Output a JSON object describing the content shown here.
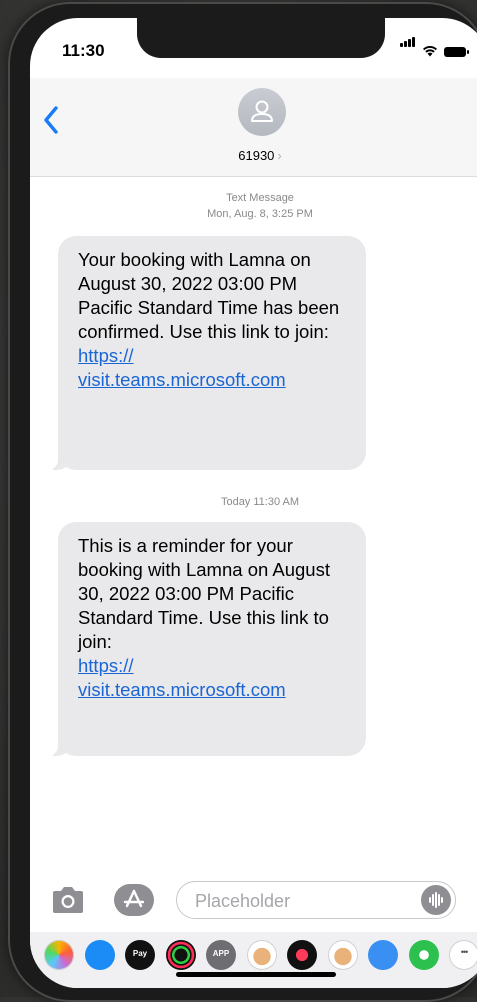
{
  "status_bar": {
    "time": "11:30"
  },
  "header": {
    "contact_name": "61930",
    "contact_chevron": "›"
  },
  "thread": {
    "messages": [
      {
        "timestamp_label": "Text Message",
        "timestamp": "Mon, Aug. 8, 3:25 PM",
        "body": "Your booking with Lamna on August 30, 2022 03:00 PM Pacific Standard Time has been confirmed. Use this link to join:",
        "link_line1": "https://",
        "link_line2": "visit.teams.microsoft.com"
      },
      {
        "timestamp": "Today 11:30 AM",
        "body": "This is a reminder for your booking with Lamna on August 30, 2022 03:00 PM Pacific Standard Time. Use this link to join:",
        "link_line1": "https://",
        "link_line2": "visit.teams.microsoft.com"
      }
    ]
  },
  "composer": {
    "placeholder": "Placeholder"
  },
  "app_drawer": {
    "apps": [
      {
        "name": "photos-app-icon",
        "color": "#ffffff"
      },
      {
        "name": "app-store-icon",
        "color": "#1b8cf5"
      },
      {
        "name": "apple-pay-icon",
        "color": "#111111",
        "label": "Pay"
      },
      {
        "name": "fitness-icon",
        "color": "#111111"
      },
      {
        "name": "app-clips-icon",
        "color": "#6d6d72",
        "label": "APP"
      },
      {
        "name": "memoji-icon",
        "color": "#ffffff"
      },
      {
        "name": "digital-touch-icon",
        "color": "#111111"
      },
      {
        "name": "animoji-icon",
        "color": "#ffffff"
      },
      {
        "name": "globe-search-icon",
        "color": "#3a8ff2"
      },
      {
        "name": "clock-icon",
        "color": "#2cc14f"
      },
      {
        "name": "more-icon",
        "color": "#ffffff"
      }
    ]
  }
}
